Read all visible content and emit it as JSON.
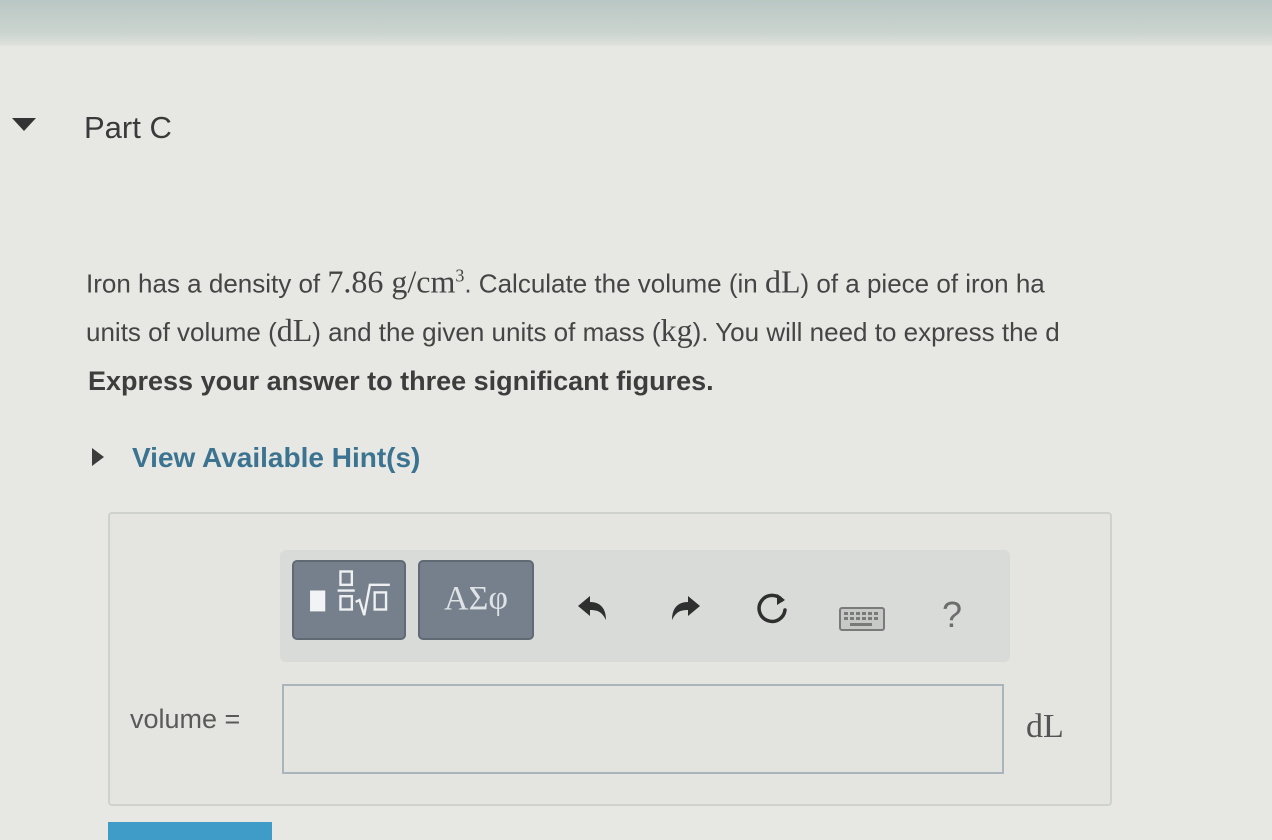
{
  "part": {
    "title": "Part C"
  },
  "question": {
    "t1": "Iron has a density of ",
    "density_value": "7.86",
    "density_unit_g": " g/cm",
    "density_unit_exp": "3",
    "t2": ". Calculate the volume (in ",
    "unit_dL_1": "dL",
    "t3": ") of a piece of iron ha",
    "t4": "units of volume (",
    "unit_dL_2": "dL",
    "t5": ") and the given units of mass (",
    "unit_kg": "kg",
    "t6": "). You will need to express the d"
  },
  "instruction": "Express your answer to three significant figures.",
  "hint": {
    "label": "View Available Hint(s)"
  },
  "toolbar": {
    "greek_label": "ΑΣφ",
    "help_label": "?"
  },
  "answer": {
    "variable_label": "volume =",
    "value": "",
    "unit": "dL"
  },
  "colors": {
    "hint_link": "#3b7390",
    "toolbar_button": "#75808c",
    "submit_button": "#3f9bc7"
  }
}
